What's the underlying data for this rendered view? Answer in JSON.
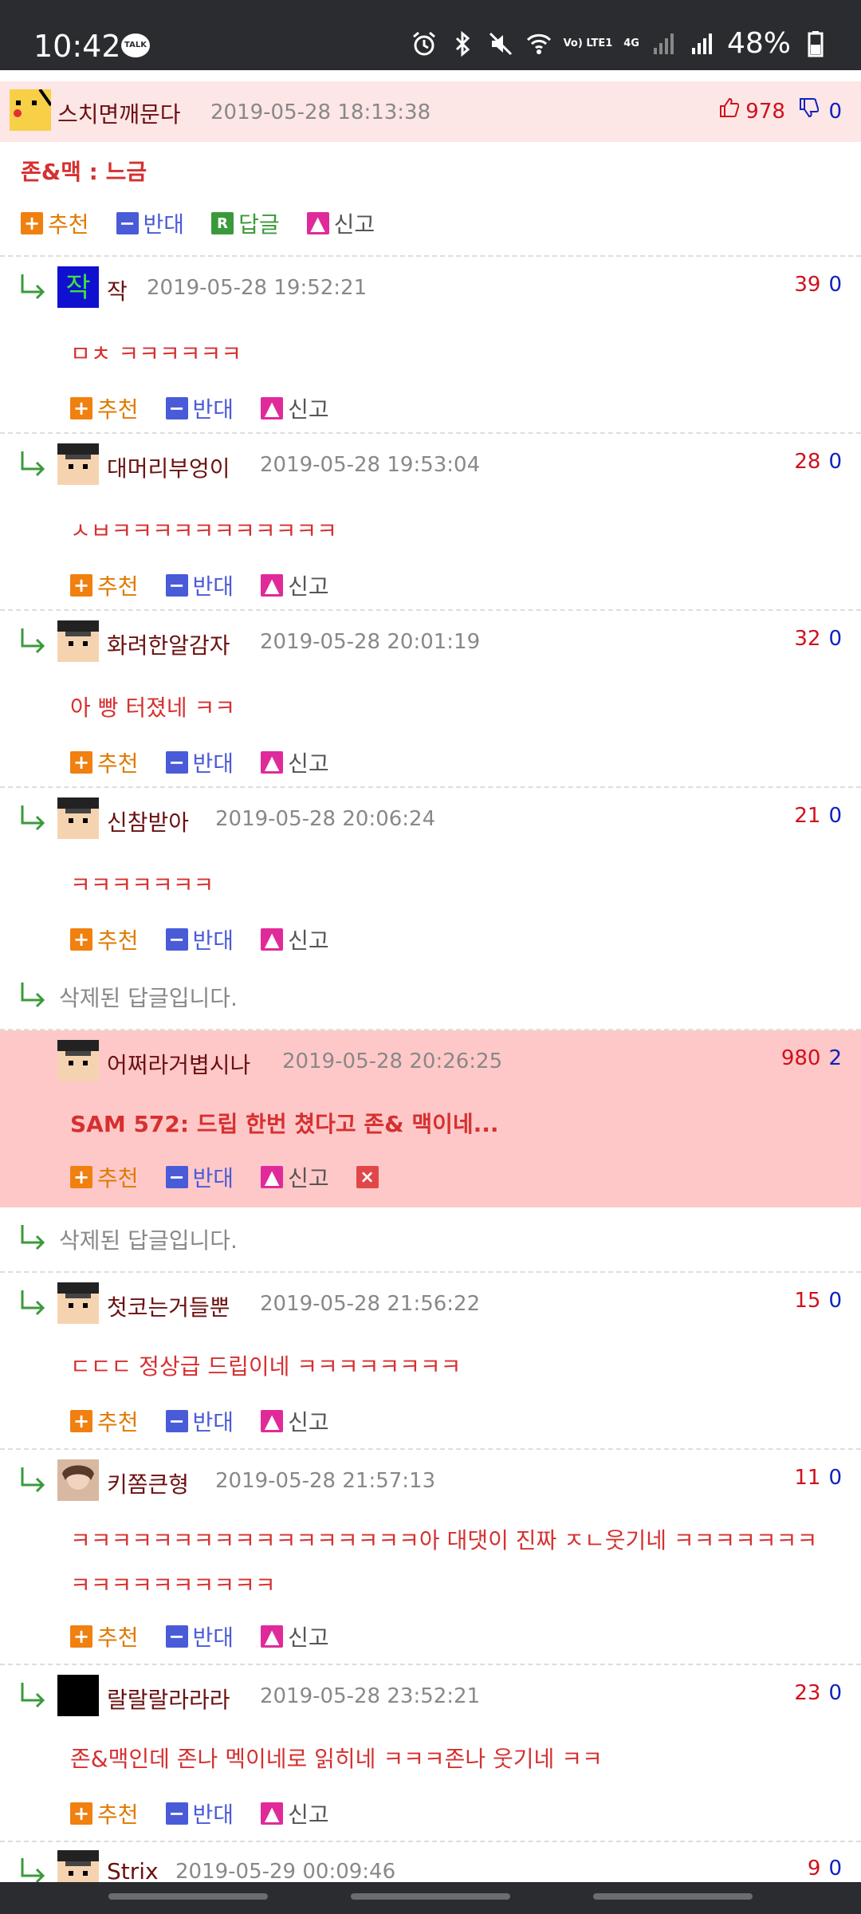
{
  "status": {
    "time": "10:42",
    "talk": "TALK",
    "network": "Vo) LTE1",
    "net4g": "4G",
    "battery": "48%"
  },
  "post": {
    "author": "스치면깨문다",
    "date": "2019-05-28 18:13:38",
    "likes": "978",
    "dislikes": "0",
    "content": "존&맥 : 느금",
    "actions": {
      "recommend": "추천",
      "oppose": "반대",
      "reply": "답글",
      "report": "신고"
    }
  },
  "comments": [
    {
      "author": "작",
      "date": "2019-05-28 19:52:21",
      "up": "39",
      "down": "0",
      "text": "ㅁㅊ ㅋㅋㅋㅋㅋㅋ"
    },
    {
      "author": "대머리부엉이",
      "date": "2019-05-28 19:53:04",
      "up": "28",
      "down": "0",
      "text": "ㅅㅂㅋㅋㅋㅋㅋㅋㅋㅋㅋㅋㅋ"
    },
    {
      "author": "화려한알감자",
      "date": "2019-05-28 20:01:19",
      "up": "32",
      "down": "0",
      "text": "아 빵 터졌네 ㅋㅋ"
    },
    {
      "author": "신참받아",
      "date": "2019-05-28 20:06:24",
      "up": "21",
      "down": "0",
      "text": "ㅋㅋㅋㅋㅋㅋㅋ"
    },
    {
      "author": "어쩌라거볍시나",
      "date": "2019-05-28 20:26:25",
      "up": "980",
      "down": "2",
      "text": "SAM 572: 드립 한번 쳤다고 존& 맥이네..."
    },
    {
      "author": "첫코는거들뿐",
      "date": "2019-05-28 21:56:22",
      "up": "15",
      "down": "0",
      "text": "ㄷㄷㄷ 정상급 드립이네 ㅋㅋㅋㅋㅋㅋㅋㅋ"
    },
    {
      "author": "키쫌큰형",
      "date": "2019-05-28 21:57:13",
      "up": "11",
      "down": "0",
      "text1": "ㅋㅋㅋㅋㅋㅋㅋㅋㅋㅋㅋㅋㅋㅋㅋㅋㅋ아 대댓이 진짜 ㅈㄴ웃기네 ㅋㅋㅋㅋㅋㅋㅋ",
      "text2": "ㅋㅋㅋㅋㅋㅋㅋㅋㅋㅋ"
    },
    {
      "author": "랄랄랄라라라",
      "date": "2019-05-28 23:52:21",
      "up": "23",
      "down": "0",
      "text": "존&맥인데 존나 멕이네로 읽히네 ㅋㅋㅋ존나 웃기네 ㅋㅋ"
    },
    {
      "author": "Strix",
      "date": "2019-05-29 00:09:46",
      "up": "9",
      "down": "0"
    }
  ],
  "deleted_text": "삭제된 답글입니다.",
  "colors": {
    "post_bg": "#fde6e6",
    "highlight_bg": "#ffc8c8",
    "like": "#d0101c",
    "dislike": "#1020c0"
  }
}
